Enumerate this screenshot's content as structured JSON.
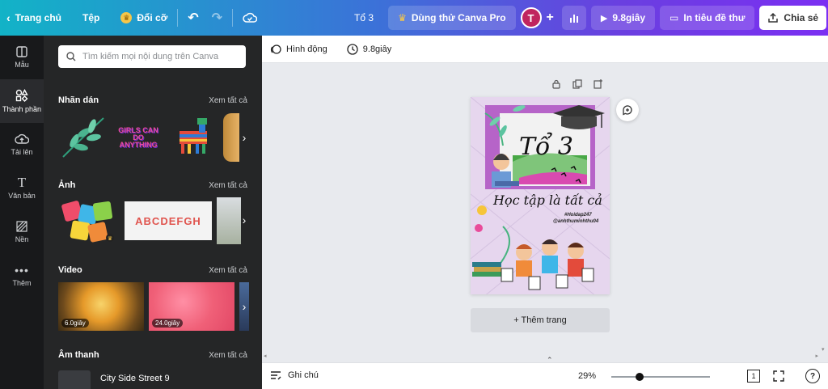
{
  "topbar": {
    "home_label": "Trang chủ",
    "file_label": "Tệp",
    "resize_label": "Đổi cỡ",
    "doc_title": "Tổ 3",
    "try_pro_label": "Dùng thử Canva Pro",
    "avatar_letter": "T",
    "play_label": "9.8giây",
    "print_label": "In tiêu đề thư",
    "share_label": "Chia sẻ"
  },
  "rail": {
    "items": [
      {
        "label": "Mẫu",
        "icon": "template-icon"
      },
      {
        "label": "Thành phần",
        "icon": "elements-icon"
      },
      {
        "label": "Tải lên",
        "icon": "upload-icon"
      },
      {
        "label": "Văn bản",
        "icon": "text-icon"
      },
      {
        "label": "Nền",
        "icon": "background-icon"
      },
      {
        "label": "Thêm",
        "icon": "more-icon"
      }
    ]
  },
  "panel": {
    "search_placeholder": "Tìm kiếm mọi nội dung trên Canva",
    "stickers": {
      "title": "Nhãn dán",
      "see_all": "Xem tất cả",
      "sticker_text": "GIRLS CAN DO ANYTHING"
    },
    "photos": {
      "title": "Ảnh",
      "see_all": "Xem tất cả",
      "letters": "ABCDEFGH"
    },
    "video": {
      "title": "Video",
      "see_all": "Xem tất cả",
      "durations": [
        "6.0giây",
        "24.0giây"
      ]
    },
    "audio": {
      "title": "Âm thanh",
      "see_all": "Xem tất cả",
      "track": "City Side Street 9"
    }
  },
  "subbar": {
    "animate_label": "Hình động",
    "duration_label": "9.8giây"
  },
  "design": {
    "title": "Tổ 3",
    "subtitle": "Học tập là tất cả",
    "hashtag": "#Hoidap247",
    "handle": "@anhthuminhthu04"
  },
  "canvas": {
    "add_page_label": "+ Thêm trang"
  },
  "bottombar": {
    "notes_label": "Ghi chú",
    "zoom": "29%",
    "zoom_fraction": 0.29,
    "page_count": "1",
    "help": "?"
  },
  "colors": {
    "accent_start": "#12b3c7",
    "accent_end": "#7b2ff2",
    "panel_bg": "#252627",
    "rail_bg": "#18191b"
  }
}
